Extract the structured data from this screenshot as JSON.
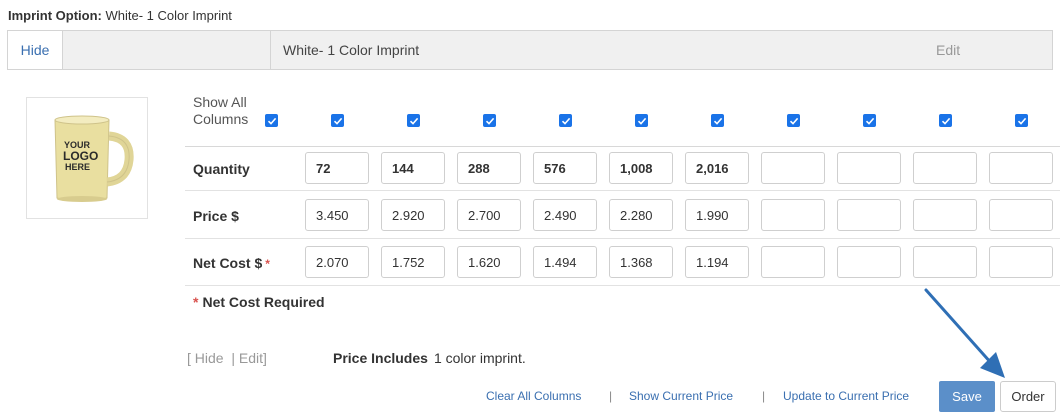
{
  "imprint_option": {
    "label": "Imprint Option:",
    "value": "White- 1 Color Imprint"
  },
  "header": {
    "hide": "Hide",
    "name": "White- 1 Color Imprint",
    "edit": "Edit"
  },
  "product": {
    "logo_line1": "YOUR",
    "logo_line2": "LOGO",
    "logo_line3": "HERE"
  },
  "show_all": {
    "line1": "Show All",
    "line2": "Columns"
  },
  "rows": {
    "quantity": {
      "label": "Quantity",
      "values": [
        "72",
        "144",
        "288",
        "576",
        "1,008",
        "2,016",
        "",
        "",
        "",
        ""
      ]
    },
    "price": {
      "label": "Price $",
      "values": [
        "3.450",
        "2.920",
        "2.700",
        "2.490",
        "2.280",
        "1.990",
        "",
        "",
        "",
        ""
      ]
    },
    "net_cost": {
      "label": "Net Cost $",
      "required_star": "*",
      "values": [
        "2.070",
        "1.752",
        "1.620",
        "1.494",
        "1.368",
        "1.194",
        "",
        "",
        "",
        ""
      ]
    }
  },
  "net_required": {
    "star": "*",
    "text": "Net Cost Required"
  },
  "links": {
    "open": "[",
    "hide": "Hide",
    "pipe": "|",
    "edit": "Edit",
    "close": "]"
  },
  "price_includes": {
    "label": "Price Includes",
    "value": "1 color imprint."
  },
  "bottom": {
    "clear": "Clear All Columns",
    "sep": "|",
    "show_current": "Show Current Price",
    "update_current": "Update to Current Price",
    "save": "Save",
    "order": "Order"
  },
  "colors": {
    "accent": "#1a73e8",
    "link": "#3a6fb0",
    "save_button": "#5b8fc9",
    "arrow": "#2f6fb5",
    "required": "#d9534f"
  }
}
